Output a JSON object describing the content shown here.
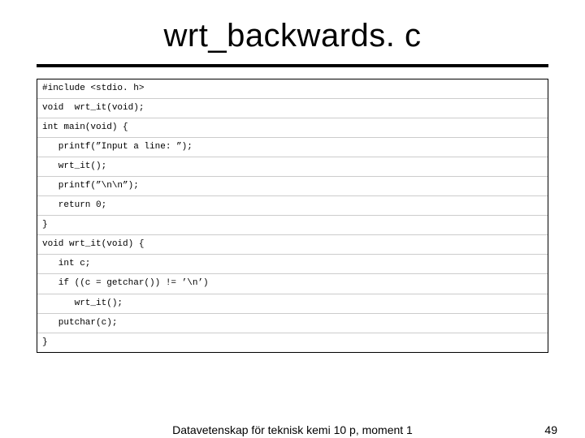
{
  "title": "wrt_backwards. c",
  "code_lines": [
    "#include <stdio. h>",
    "void  wrt_it(void);",
    "int main(void) {",
    "   printf(”Input a line: ”);",
    "   wrt_it();",
    "   printf(”\\n\\n”);",
    "   return 0;",
    "}",
    "void wrt_it(void) {",
    "   int c;",
    "   if ((c = getchar()) != ’\\n’)",
    "      wrt_it();",
    "   putchar(c);",
    "}"
  ],
  "footer_text": "Datavetenskap för teknisk kemi 10 p, moment 1",
  "page_number": "49"
}
